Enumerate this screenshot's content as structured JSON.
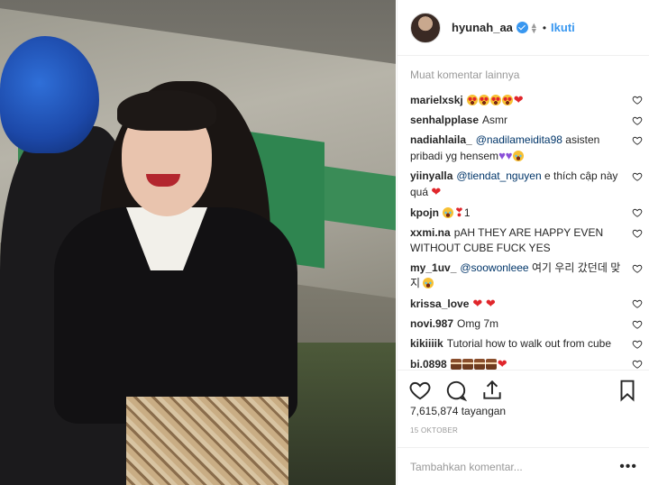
{
  "post": {
    "username": "hyunah_aa",
    "separator": "•",
    "follow_label": "Ikuti",
    "load_more_label": "Muat komentar lainnya",
    "comments": [
      {
        "user": "marielxskj",
        "parts": [
          {
            "t": "emoji",
            "v": "heart-eyes"
          },
          {
            "t": "emoji",
            "v": "heart-eyes"
          },
          {
            "t": "emoji",
            "v": "heart-eyes"
          },
          {
            "t": "emoji",
            "v": "heart-eyes"
          },
          {
            "t": "heart",
            "v": "❤"
          }
        ]
      },
      {
        "user": "senhalpplase",
        "parts": [
          {
            "t": "text",
            "v": "Asmr"
          }
        ]
      },
      {
        "user": "nadiahlaila_",
        "parts": [
          {
            "t": "mention",
            "v": "@nadilameidita98"
          },
          {
            "t": "text",
            "v": " asisten pribadi yg hensem"
          },
          {
            "t": "heart-purple",
            "v": "♥♥"
          },
          {
            "t": "emoji",
            "v": "laugh"
          }
        ]
      },
      {
        "user": "yiinyalla",
        "parts": [
          {
            "t": "mention",
            "v": "@tiendat_nguyen"
          },
          {
            "t": "text",
            "v": " e thích cập này quá "
          },
          {
            "t": "heart",
            "v": "❤"
          }
        ]
      },
      {
        "user": "kpojn",
        "parts": [
          {
            "t": "emoji",
            "v": "laugh"
          },
          {
            "t": "heart",
            "v": "❣"
          },
          {
            "t": "text",
            "v": "1"
          }
        ]
      },
      {
        "user": "xxmi.na",
        "parts": [
          {
            "t": "text",
            "v": "pAH THEY ARE HAPPY EVEN WITHOUT CUBE FUCK YES"
          }
        ]
      },
      {
        "user": "my_1uv_",
        "parts": [
          {
            "t": "mention",
            "v": "@soowonleee"
          },
          {
            "t": "text",
            "v": " 여기 우리 갔던데 맞지 "
          },
          {
            "t": "emoji",
            "v": "laugh"
          }
        ]
      },
      {
        "user": "krissa_love",
        "parts": [
          {
            "t": "heart",
            "v": "❤ ❤"
          }
        ]
      },
      {
        "user": "novi.987",
        "parts": [
          {
            "t": "text",
            "v": "Omg 7m"
          }
        ]
      },
      {
        "user": "kikiiiik",
        "parts": [
          {
            "t": "text",
            "v": "Tutorial how to walk out from cube"
          }
        ]
      },
      {
        "user": "bi.0898",
        "parts": [
          {
            "t": "emoji",
            "v": "cake"
          },
          {
            "t": "emoji",
            "v": "cake"
          },
          {
            "t": "emoji",
            "v": "cake"
          },
          {
            "t": "emoji",
            "v": "cake"
          },
          {
            "t": "heart",
            "v": "❤"
          }
        ]
      }
    ],
    "views_label": "7,615,874 tayangan",
    "date_label": "15 OKTOBER",
    "comment_placeholder": "Tambahkan komentar...",
    "more_label": "•••"
  },
  "icons": {
    "like": "heart-outline-icon",
    "comment": "speech-bubble-icon",
    "share": "share-arrow-icon",
    "save": "bookmark-icon"
  },
  "colors": {
    "accent": "#3897f0",
    "text": "#262626",
    "muted": "#999999",
    "heart": "#e0262b"
  }
}
